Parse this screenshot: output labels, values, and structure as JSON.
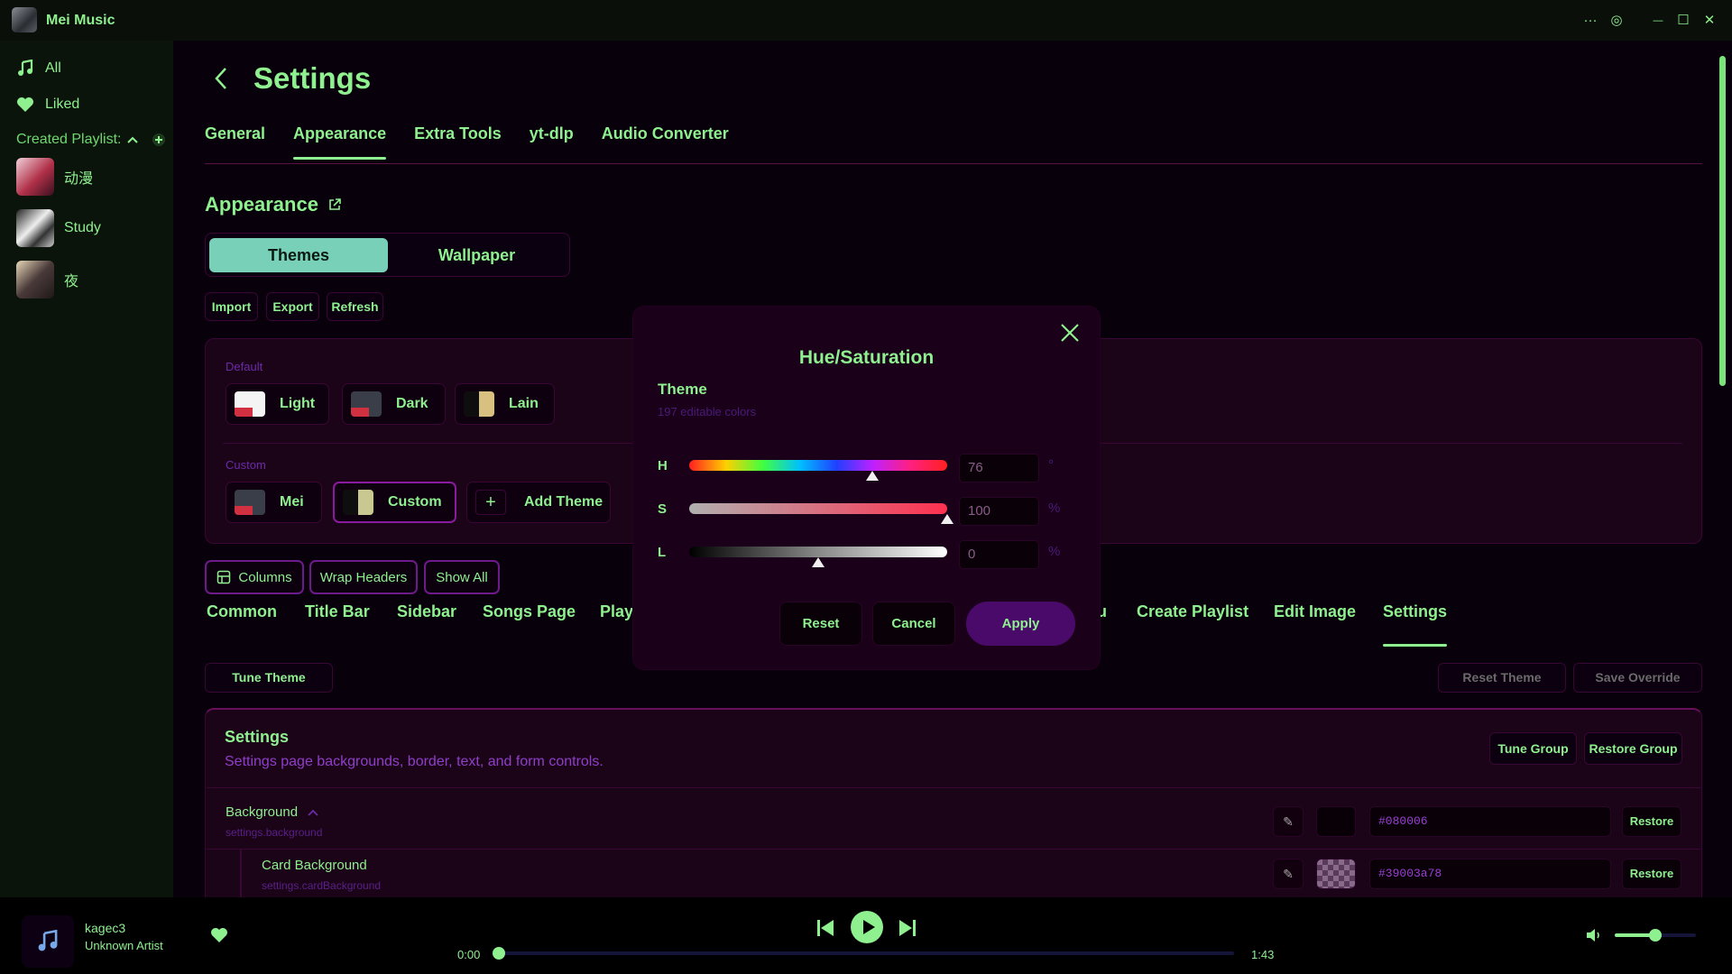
{
  "app": {
    "title": "Mei Music"
  },
  "titlebar": {
    "more": "···",
    "target": "◎",
    "minimize": "—",
    "maximize": "☐",
    "close": "✕"
  },
  "sidebar": {
    "all": "All",
    "liked": "Liked",
    "created_playlists": "Created Playlist:",
    "playlists": [
      {
        "name": "动漫"
      },
      {
        "name": "Study"
      },
      {
        "name": "夜"
      }
    ]
  },
  "page": {
    "title": "Settings",
    "tabs": [
      "General",
      "Appearance",
      "Extra Tools",
      "yt-dlp",
      "Audio Converter"
    ],
    "active_tab": "Appearance"
  },
  "appearance": {
    "title": "Appearance",
    "segments": [
      "Themes",
      "Wallpaper"
    ],
    "active_segment": "Themes",
    "actions": [
      "Import",
      "Export",
      "Refresh"
    ]
  },
  "themes": {
    "default_label": "Default",
    "custom_label": "Custom",
    "default": [
      {
        "name": "Light"
      },
      {
        "name": "Dark"
      },
      {
        "name": "Lain"
      }
    ],
    "custom": [
      {
        "name": "Mei"
      },
      {
        "name": "Custom"
      }
    ],
    "add": "Add Theme"
  },
  "tools": {
    "columns": "Columns",
    "wrap_headers": "Wrap Headers",
    "show_all": "Show All"
  },
  "subtabs": {
    "items": [
      "Common",
      "Title Bar",
      "Sidebar",
      "Songs Page",
      "Playl",
      "u",
      "Create Playlist",
      "Edit Image",
      "Settings"
    ],
    "active": "Settings"
  },
  "actions": {
    "tune_theme": "Tune Theme",
    "reset_theme": "Reset Theme",
    "save_override": "Save Override"
  },
  "settings_group": {
    "title": "Settings",
    "description": "Settings page backgrounds, border, text, and form controls.",
    "tune_group": "Tune Group",
    "restore_group": "Restore Group",
    "rows": [
      {
        "label": "Background",
        "key": "settings.background",
        "hex": "#080006",
        "restore": "Restore"
      },
      {
        "label": "Card Background",
        "key": "settings.cardBackground",
        "hex": "#39003a78",
        "restore": "Restore"
      }
    ]
  },
  "dialog": {
    "title": "Hue/Saturation",
    "theme": "Theme",
    "subtitle": "197 editable colors",
    "h_label": "H",
    "s_label": "S",
    "l_label": "L",
    "h": "76",
    "s": "100",
    "l": "0",
    "h_unit": "°",
    "s_unit": "%",
    "l_unit": "%",
    "h_level": 0.71,
    "s_level": 1.0,
    "l_level": 0.5,
    "reset": "Reset",
    "cancel": "Cancel",
    "apply": "Apply"
  },
  "player": {
    "track": "kagec3",
    "artist": "Unknown Artist",
    "elapsed": "0:00",
    "duration": "1:43",
    "progress": 0.0,
    "volume": 0.5
  },
  "colors": {
    "accent": "#8ff08f",
    "teal": "#78d0b8",
    "purple": "#4a0a6a",
    "panel": "#1c0418",
    "text_purple": "#8f3ec9"
  }
}
